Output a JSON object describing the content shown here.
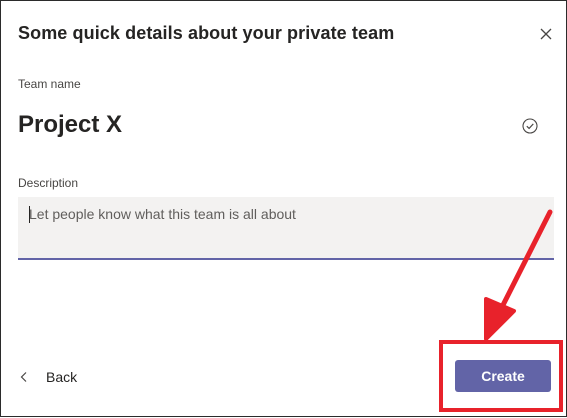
{
  "dialog": {
    "title": "Some quick details about your private team",
    "close_icon": "close-icon"
  },
  "team_name": {
    "label": "Team name",
    "value": "Project X",
    "status_icon": "check-circle-icon"
  },
  "description": {
    "label": "Description",
    "value": "",
    "placeholder": "Let people know what this team is all about"
  },
  "footer": {
    "back_label": "Back",
    "back_icon": "chevron-left-icon",
    "create_label": "Create"
  },
  "colors": {
    "accent": "#6264a7",
    "annotation": "#e8222b",
    "input_background": "#f3f2f1"
  },
  "annotation": {
    "type": "highlight-box-with-arrow",
    "target": "create-button"
  }
}
